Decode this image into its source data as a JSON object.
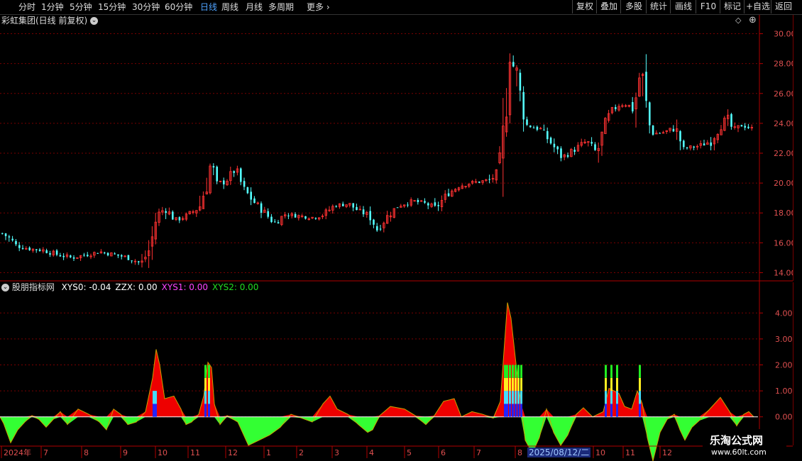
{
  "periods": [
    {
      "label": "分时",
      "active": false
    },
    {
      "label": "1分钟",
      "active": false
    },
    {
      "label": "5分钟",
      "active": false
    },
    {
      "label": "15分钟",
      "active": false
    },
    {
      "label": "30分钟",
      "active": false
    },
    {
      "label": "60分钟",
      "active": false
    },
    {
      "label": "日线",
      "active": true
    },
    {
      "label": "周线",
      "active": false
    },
    {
      "label": "月线",
      "active": false
    },
    {
      "label": "多周期",
      "active": false
    },
    {
      "label": "更多",
      "active": false
    }
  ],
  "tools": [
    "复权",
    "叠加",
    "多股",
    "统计",
    "画线",
    "F10",
    "标记",
    "+自选",
    "返回"
  ],
  "chart_title": "彩虹集团(日线 前复权)",
  "indicator": {
    "name": "股朋指标网",
    "values": [
      {
        "label": "XYS0:",
        "value": "-0.04",
        "color": "#ffffff"
      },
      {
        "label": "ZZX:",
        "value": "0.00",
        "color": "#ffffff"
      },
      {
        "label": "XYS1:",
        "value": "0.00",
        "color": "#ff44ff"
      },
      {
        "label": "XYS2:",
        "value": "0.00",
        "color": "#22dd22"
      }
    ]
  },
  "price_ticks": [
    "30.00",
    "28.00",
    "26.00",
    "24.00",
    "22.00",
    "20.00",
    "18.00",
    "16.00",
    "14.00"
  ],
  "ind_ticks": [
    "4.00",
    "3.00",
    "2.00",
    "1.00",
    "0.00"
  ],
  "x_labels": [
    "2024年",
    "7",
    "8",
    "9",
    "10",
    "11",
    "12",
    "1",
    "2",
    "3",
    "4",
    "5",
    "6",
    "7",
    "8",
    "10",
    "11",
    "12"
  ],
  "date_cursor": "2025/08/12/二",
  "watermark": {
    "title": "乐淘公式网",
    "url": "www.60lt.com"
  },
  "colors": {
    "up": "#ff3232",
    "down": "#54ffff",
    "grid": "#7a0000",
    "axis": "#b00000",
    "red_fill": "#ee0000",
    "green_fill": "#33ff33"
  },
  "chart_data": [
    {
      "type": "candlestick",
      "title": "彩虹集团(日线 前复权)",
      "x_labels": [
        "2024年",
        "7",
        "8",
        "9",
        "10",
        "11",
        "12",
        "1",
        "2",
        "3",
        "4",
        "5",
        "6",
        "7",
        "8",
        "10",
        "11",
        "12"
      ],
      "ylim": [
        13.5,
        30.5
      ],
      "y_ticks": [
        14,
        16,
        18,
        20,
        22,
        24,
        26,
        28,
        30
      ],
      "close_path": [
        [
          0,
          16.7
        ],
        [
          12,
          16.3
        ],
        [
          22,
          15.8
        ],
        [
          40,
          15.6
        ],
        [
          60,
          15.5
        ],
        [
          80,
          15.2
        ],
        [
          100,
          15.0
        ],
        [
          120,
          15.2
        ],
        [
          140,
          15.4
        ],
        [
          160,
          15.2
        ],
        [
          180,
          15.0
        ],
        [
          198,
          14.6
        ],
        [
          210,
          15.6
        ],
        [
          220,
          17.9
        ],
        [
          232,
          18.3
        ],
        [
          245,
          17.5
        ],
        [
          262,
          17.8
        ],
        [
          280,
          18.4
        ],
        [
          290,
          20.0
        ],
        [
          296,
          21.4
        ],
        [
          304,
          20.0
        ],
        [
          316,
          20.1
        ],
        [
          330,
          20.9
        ],
        [
          342,
          19.6
        ],
        [
          355,
          18.8
        ],
        [
          372,
          18.0
        ],
        [
          385,
          17.3
        ],
        [
          400,
          17.9
        ],
        [
          420,
          17.8
        ],
        [
          440,
          17.7
        ],
        [
          455,
          17.9
        ],
        [
          470,
          18.5
        ],
        [
          490,
          18.6
        ],
        [
          505,
          18.1
        ],
        [
          520,
          17.8
        ],
        [
          530,
          16.9
        ],
        [
          545,
          17.8
        ],
        [
          560,
          18.5
        ],
        [
          580,
          18.8
        ],
        [
          600,
          18.6
        ],
        [
          612,
          18.3
        ],
        [
          630,
          19.3
        ],
        [
          645,
          19.8
        ],
        [
          660,
          20.0
        ],
        [
          690,
          20.2
        ],
        [
          705,
          21.0
        ],
        [
          712,
          25.5
        ],
        [
          716,
          28.7
        ],
        [
          720,
          28.0
        ],
        [
          726,
          27.5
        ],
        [
          732,
          25.8
        ],
        [
          740,
          23.9
        ],
        [
          760,
          23.6
        ],
        [
          778,
          22.5
        ],
        [
          790,
          21.7
        ],
        [
          810,
          22.3
        ],
        [
          825,
          22.8
        ],
        [
          840,
          22.0
        ],
        [
          852,
          24.0
        ],
        [
          860,
          24.8
        ],
        [
          870,
          25.2
        ],
        [
          880,
          25.3
        ],
        [
          892,
          25.0
        ],
        [
          902,
          27.7
        ],
        [
          908,
          25.5
        ],
        [
          916,
          23.3
        ],
        [
          935,
          23.4
        ],
        [
          950,
          23.7
        ],
        [
          962,
          22.3
        ],
        [
          985,
          22.5
        ],
        [
          1000,
          22.8
        ],
        [
          1012,
          23.7
        ],
        [
          1022,
          24.4
        ],
        [
          1032,
          23.5
        ],
        [
          1045,
          23.9
        ],
        [
          1060,
          23.6
        ]
      ],
      "candle_step": 4.8
    },
    {
      "type": "area",
      "title": "股朋指标网",
      "ylim": [
        -1.1,
        4.8
      ],
      "y_ticks": [
        0,
        1,
        2,
        3,
        4
      ],
      "series": [
        {
          "name": "XYS0",
          "values": [
            [
              0,
              0
            ],
            [
              5,
              -0.25
            ],
            [
              15,
              -1.0
            ],
            [
              25,
              -0.5
            ],
            [
              35,
              -0.2
            ],
            [
              45,
              0.05
            ],
            [
              55,
              -0.1
            ],
            [
              65,
              -0.4
            ],
            [
              75,
              -0.1
            ],
            [
              85,
              0.2
            ],
            [
              95,
              -0.3
            ],
            [
              110,
              0.3
            ],
            [
              125,
              0.1
            ],
            [
              140,
              -0.2
            ],
            [
              150,
              -0.5
            ],
            [
              160,
              0.3
            ],
            [
              170,
              0.1
            ],
            [
              180,
              -0.3
            ],
            [
              192,
              -0.2
            ],
            [
              205,
              0.2
            ],
            [
              215,
              1.5
            ],
            [
              220,
              2.6
            ],
            [
              225,
              2.0
            ],
            [
              232,
              0.7
            ],
            [
              245,
              0.8
            ],
            [
              255,
              0.3
            ],
            [
              262,
              -0.3
            ],
            [
              270,
              -0.2
            ],
            [
              280,
              0.1
            ],
            [
              287,
              0.8
            ],
            [
              293,
              2.1
            ],
            [
              298,
              1.9
            ],
            [
              302,
              0.5
            ],
            [
              310,
              -0.3
            ],
            [
              320,
              0.05
            ],
            [
              335,
              -0.2
            ],
            [
              350,
              -1.1
            ],
            [
              365,
              -0.9
            ],
            [
              380,
              -0.7
            ],
            [
              395,
              -0.4
            ],
            [
              410,
              0.1
            ],
            [
              425,
              -0.05
            ],
            [
              440,
              -0.2
            ],
            [
              455,
              0.5
            ],
            [
              465,
              0.8
            ],
            [
              475,
              0.3
            ],
            [
              490,
              0.1
            ],
            [
              505,
              -0.3
            ],
            [
              518,
              -0.6
            ],
            [
              525,
              -0.5
            ],
            [
              535,
              0.05
            ],
            [
              550,
              0.4
            ],
            [
              570,
              0.3
            ],
            [
              585,
              0.05
            ],
            [
              600,
              -0.3
            ],
            [
              612,
              0.05
            ],
            [
              625,
              0.6
            ],
            [
              640,
              0.7
            ],
            [
              650,
              0.0
            ],
            [
              665,
              0.2
            ],
            [
              680,
              0.1
            ],
            [
              695,
              -0.05
            ],
            [
              705,
              0.6
            ],
            [
              710,
              2.5
            ],
            [
              715,
              4.4
            ],
            [
              720,
              3.8
            ],
            [
              728,
              1.8
            ],
            [
              734,
              0.5
            ],
            [
              740,
              -0.9
            ],
            [
              750,
              -1.4
            ],
            [
              760,
              -0.8
            ],
            [
              770,
              0.3
            ],
            [
              780,
              -0.6
            ],
            [
              790,
              -1.1
            ],
            [
              800,
              -0.7
            ],
            [
              812,
              0.1
            ],
            [
              822,
              0.35
            ],
            [
              835,
              0.0
            ],
            [
              850,
              0.2
            ],
            [
              858,
              1.1
            ],
            [
              865,
              1.0
            ],
            [
              872,
              0.9
            ],
            [
              880,
              0.4
            ],
            [
              890,
              0.3
            ],
            [
              898,
              1.0
            ],
            [
              905,
              0.5
            ],
            [
              912,
              -0.8
            ],
            [
              920,
              -1.7
            ],
            [
              930,
              -0.6
            ],
            [
              940,
              -0.1
            ],
            [
              950,
              0.1
            ],
            [
              958,
              -0.5
            ],
            [
              965,
              -0.9
            ],
            [
              975,
              -0.4
            ],
            [
              985,
              -0.15
            ],
            [
              1000,
              0.3
            ],
            [
              1015,
              0.75
            ],
            [
              1028,
              0.2
            ],
            [
              1038,
              -0.35
            ],
            [
              1048,
              0.1
            ],
            [
              1055,
              0.2
            ],
            [
              1062,
              0.0
            ]
          ]
        }
      ]
    }
  ]
}
